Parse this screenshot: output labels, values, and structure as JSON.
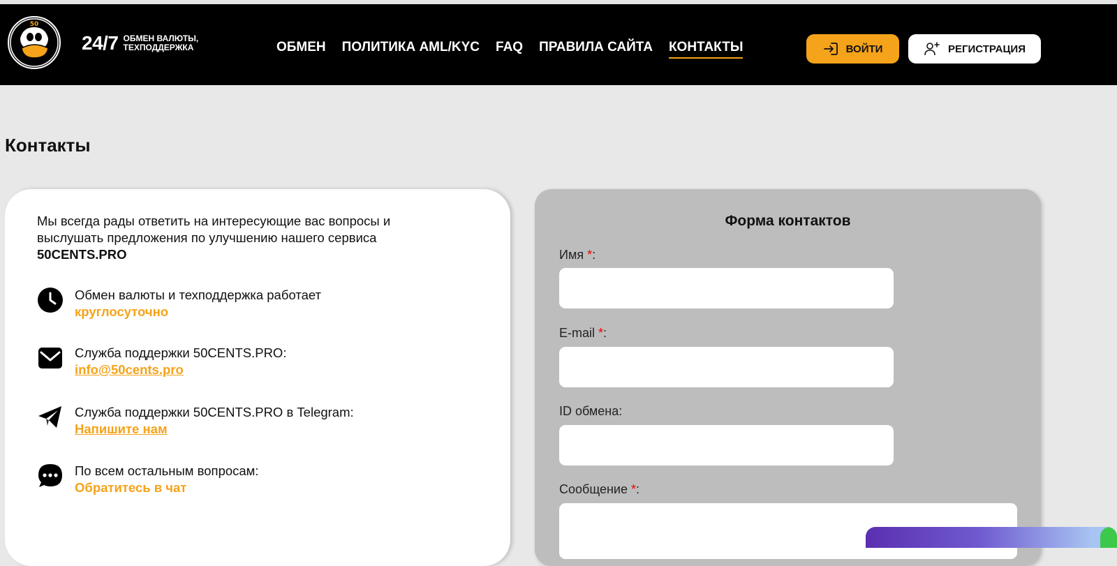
{
  "header": {
    "logo_text": "FIFTY 50 CENTS",
    "tagline_big": "24/7",
    "tagline_line1": "ОБМЕН ВАЛЮТЫ,",
    "tagline_line2": "ТЕХПОДДЕРЖКА",
    "nav": [
      {
        "label": "ОБМЕН",
        "active": false
      },
      {
        "label": "ПОЛИТИКА AML/KYC",
        "active": false
      },
      {
        "label": "FAQ",
        "active": false
      },
      {
        "label": "ПРАВИЛА САЙТА",
        "active": false
      },
      {
        "label": "КОНТАКТЫ",
        "active": true
      }
    ],
    "login_label": "ВОЙТИ",
    "register_label": "РЕГИСТРАЦИЯ"
  },
  "page_title": "Контакты",
  "info": {
    "intro_text": "Мы всегда рады ответить на интересующие вас вопросы и выслушать предложения по улучшению нашего сервиса",
    "intro_brand": "50CENTS.PRO",
    "items": [
      {
        "icon": "clock-icon",
        "text": "Обмен валюты и техподдержка работает",
        "accent": "круглосуточно"
      },
      {
        "icon": "envelope-icon",
        "text": "Служба поддержки 50CENTS.PRO:",
        "accent": "info@50cents.pro"
      },
      {
        "icon": "telegram-icon",
        "text": "Служба поддержки 50CENTS.PRO в Telegram:",
        "accent": "Напишите нам"
      },
      {
        "icon": "chat-bubble-icon",
        "text": "По всем остальным вопросам:",
        "accent": "Обратитесь в чат"
      }
    ]
  },
  "form": {
    "title": "Форма контактов",
    "name_label": "Имя",
    "email_label": "E-mail",
    "exchange_id_label": "ID обмена",
    "message_label": "Сообщение",
    "required_mark": "*",
    "colon": ":",
    "name_value": "",
    "email_value": "",
    "exchange_id_value": "",
    "message_value": ""
  },
  "colors": {
    "accent": "#f5a31a",
    "header_bg": "#000000",
    "page_bg": "#e8e8e8",
    "form_bg": "#bdbdbd",
    "required": "#e00000"
  }
}
